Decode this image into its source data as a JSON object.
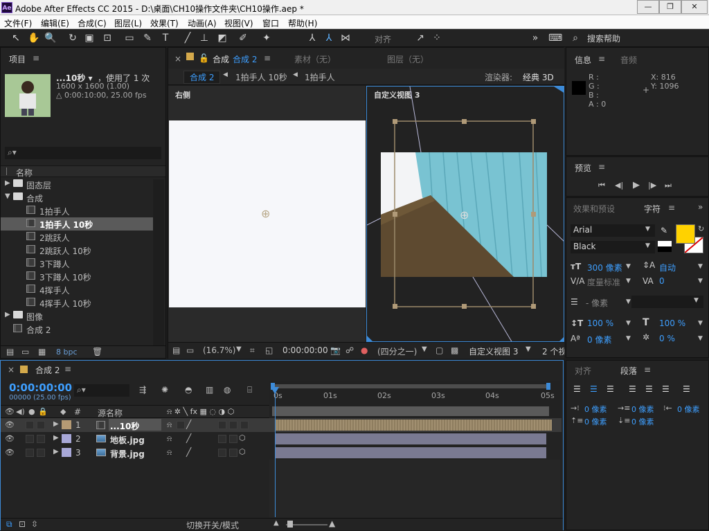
{
  "window": {
    "title": "Adobe After Effects CC 2015 - D:\\桌面\\CH10操作文件夹\\CH10操作.aep *",
    "app_icon": "Ae",
    "min": "—",
    "max": "❐",
    "close": "✕"
  },
  "menu": [
    "文件(F)",
    "编辑(E)",
    "合成(C)",
    "图层(L)",
    "效果(T)",
    "动画(A)",
    "视图(V)",
    "窗口",
    "帮助(H)"
  ],
  "toolbar": {
    "snap_label": "对齐",
    "search_label": "搜索帮助"
  },
  "project": {
    "tab": "项目",
    "item_name": "...10秒 ▾",
    "used": "，使用了 1 次",
    "dims": "1600 x 1600 (1.00)",
    "duration": "△ 0:00:10:00, 25.00 fps",
    "col_name": "名称",
    "bpc": "8 bpc",
    "items": [
      {
        "label": "固态层",
        "type": "folder",
        "expand": "▶"
      },
      {
        "label": "合成",
        "type": "folder",
        "expand": "▼"
      },
      {
        "label": "1拍手人",
        "type": "comp"
      },
      {
        "label": "1拍手人 10秒",
        "type": "comp"
      },
      {
        "label": "2跳跃人",
        "type": "comp"
      },
      {
        "label": "2跳跃人 10秒",
        "type": "comp"
      },
      {
        "label": "3下蹲人",
        "type": "comp"
      },
      {
        "label": "3下蹲人 10秒",
        "type": "comp"
      },
      {
        "label": "4挥手人",
        "type": "comp"
      },
      {
        "label": "4挥手人 10秒",
        "type": "comp"
      },
      {
        "label": "图像",
        "type": "folder",
        "expand": "▶"
      },
      {
        "label": "合成 2",
        "type": "comp"
      }
    ]
  },
  "viewer": {
    "comp_tab": "合成",
    "comp_tab_name": "合成 2",
    "footage_tab": "素材（无）",
    "layer_tab": "图层（无）",
    "breadcrumb": [
      "合成 2",
      "1拍手人 10秒",
      "1拍手人"
    ],
    "renderer_label": "渲染器:",
    "renderer": "经典 3D",
    "left_view": "右侧",
    "right_view": "自定义视图 3",
    "zoom": "(16.7%)",
    "timecode": "0:00:00:00",
    "resolution": "(四分之一)",
    "view_select": "自定义视图 3",
    "views": "2 个视"
  },
  "info": {
    "tab": "信息",
    "audio_tab": "音频",
    "r": "R :",
    "g": "G :",
    "b": "B :",
    "a": "A : 0",
    "x": "X: 816",
    "y": "Y: 1096"
  },
  "preview": {
    "tab": "预览"
  },
  "effects": {
    "tab": "效果和预设",
    "char_tab": "字符"
  },
  "character": {
    "font": "Arial",
    "style": "Black",
    "size": "300 像素",
    "leading": "自动",
    "kerning": "度量标准",
    "tracking": "0",
    "stroke": "- 像素",
    "vscale": "100 %",
    "hscale": "100 %",
    "baseline": "0 像素",
    "tsume": "0 %",
    "fill_color": "#ffd200"
  },
  "paragraph": {
    "align_tab": "对齐",
    "para_tab": "段落",
    "indent_left": "0 像素",
    "indent_first": "0 像素",
    "indent_right": "0 像素",
    "space_before": "0 像素",
    "space_after": "0 像素"
  },
  "timeline": {
    "tab": "合成 2",
    "timecode": "0:00:00:00",
    "fps": "00000 (25.00 fps)",
    "col_src": "源名称",
    "col_num": "#",
    "switch_label": "切换开关/模式",
    "ruler": [
      "0s",
      "01s",
      "02s",
      "03s",
      "04s",
      "05s"
    ],
    "layers": [
      {
        "num": "1",
        "name": "...10秒",
        "label_color": "#b59a74"
      },
      {
        "num": "2",
        "name": "地板.jpg",
        "label_color": "#a8a8d8"
      },
      {
        "num": "3",
        "name": "背景.jpg",
        "label_color": "#a8a8d8"
      }
    ]
  }
}
